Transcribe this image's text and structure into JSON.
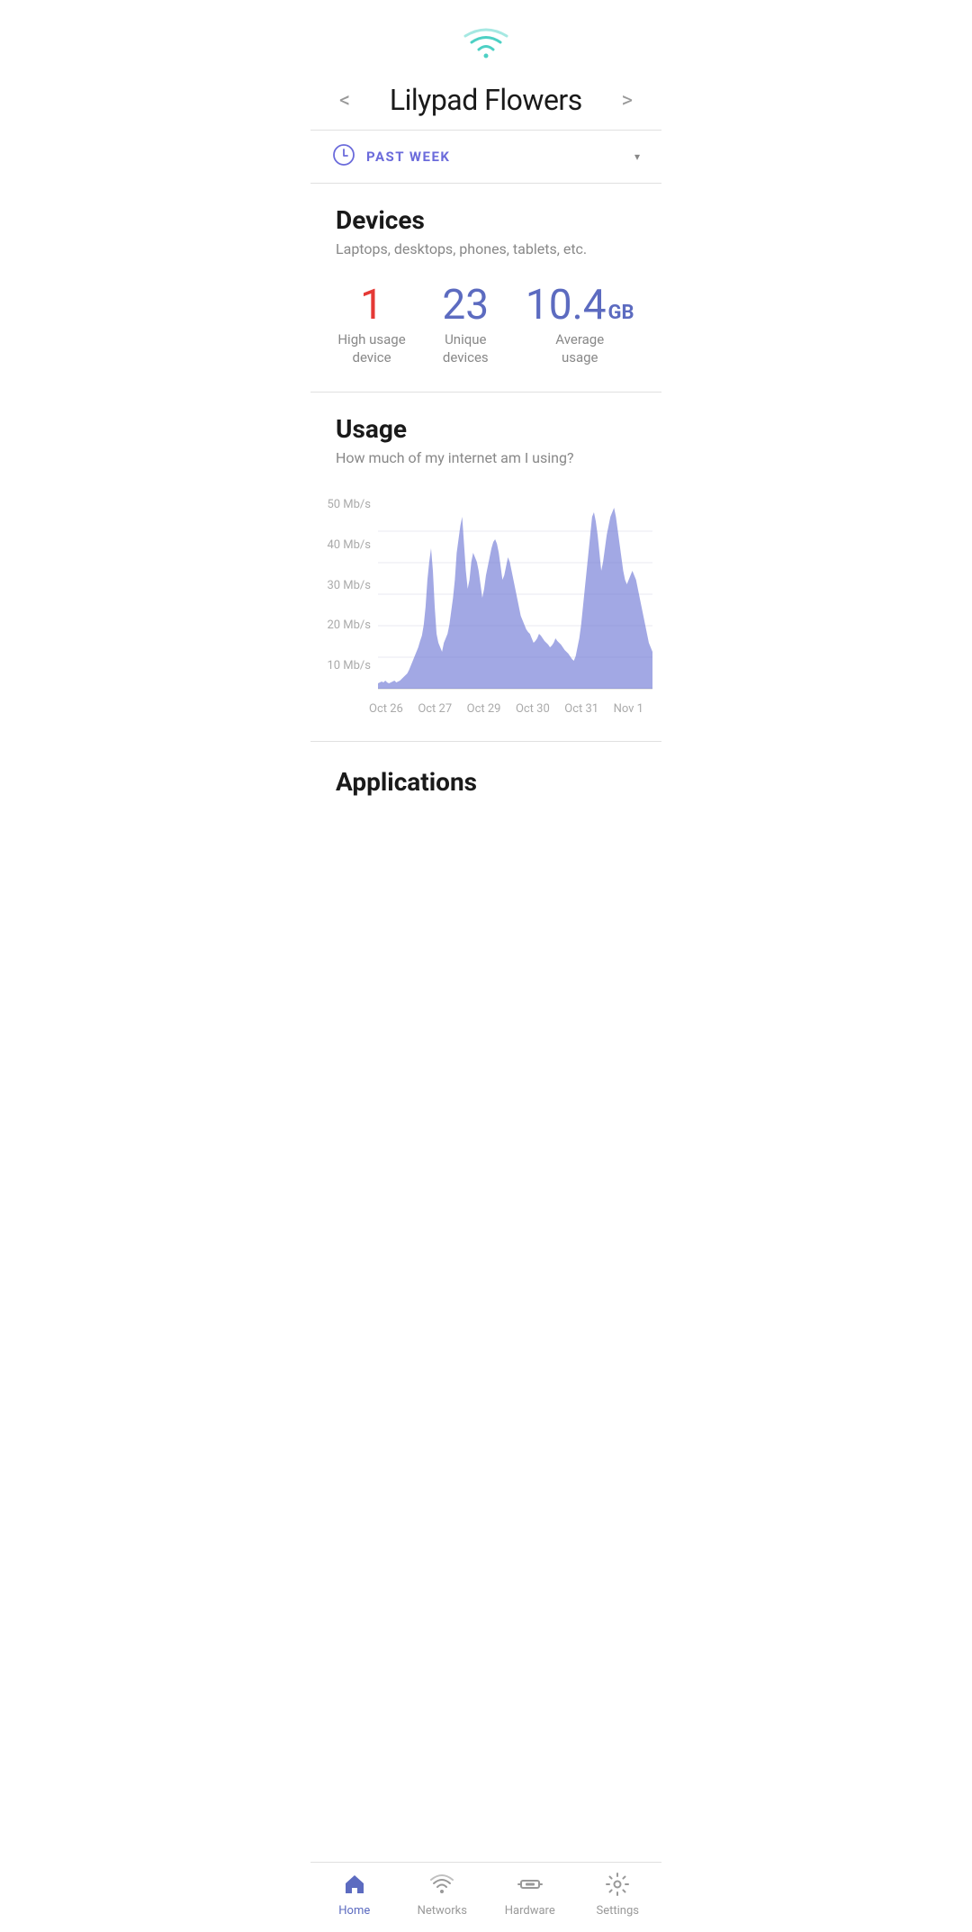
{
  "header": {
    "network_name": "Lilypad Flowers",
    "prev_arrow": "<",
    "next_arrow": ">"
  },
  "period": {
    "label": "PAST WEEK",
    "dropdown_icon": "▾"
  },
  "devices": {
    "title": "Devices",
    "subtitle": "Laptops, desktops, phones, tablets, etc.",
    "stats": [
      {
        "value": "1",
        "label": "High usage\ndevice",
        "color": "red"
      },
      {
        "value": "23",
        "label": "Unique\ndevices",
        "color": "purple"
      },
      {
        "value": "10.4",
        "unit": "GB",
        "label": "Average\nusage",
        "color": "purple-gb"
      }
    ]
  },
  "usage": {
    "title": "Usage",
    "subtitle": "How much of my internet am I using?",
    "y_labels": [
      "10 Mb/s",
      "20 Mb/s",
      "30 Mb/s",
      "40 Mb/s",
      "50 Mb/s"
    ],
    "x_labels": [
      "Oct 26",
      "Oct 27",
      "Oct 29",
      "Oct 30",
      "Oct 31",
      "Nov 1"
    ]
  },
  "applications": {
    "title": "Applications"
  },
  "bottom_nav": [
    {
      "id": "home",
      "label": "Home",
      "active": true
    },
    {
      "id": "networks",
      "label": "Networks",
      "active": false
    },
    {
      "id": "hardware",
      "label": "Hardware",
      "active": false
    },
    {
      "id": "settings",
      "label": "Settings",
      "active": false
    }
  ]
}
